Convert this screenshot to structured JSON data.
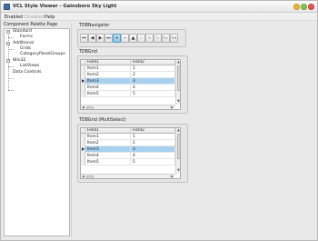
{
  "window": {
    "title": "VCL Style Viewer - Gainsboro Sky Light"
  },
  "menu": {
    "items": [
      "Enabled",
      "Disabled",
      "Help"
    ]
  },
  "left_panel": {
    "header": "Component Palette Page",
    "tree": [
      {
        "label": "Standard",
        "expanded": true
      },
      {
        "label": "Forms",
        "expanded": null
      },
      {
        "label": "Additional",
        "expanded": true
      },
      {
        "label": "Grids",
        "expanded": null
      },
      {
        "label": "CategoryPanelGroups",
        "expanded": null
      },
      {
        "label": "Win32",
        "expanded": true
      },
      {
        "label": "ListViews",
        "expanded": null
      },
      {
        "label": "Data Controls",
        "expanded": null
      }
    ]
  },
  "navigator_group": {
    "label": "TDBNavigator",
    "buttons": [
      {
        "icon": "first-record-icon",
        "glyph": "⏮"
      },
      {
        "icon": "prior-record-icon",
        "glyph": "◀"
      },
      {
        "icon": "next-record-icon",
        "glyph": "▶"
      },
      {
        "icon": "last-record-icon",
        "glyph": "⏭"
      },
      {
        "icon": "insert-record-icon",
        "glyph": "+",
        "active": true
      },
      {
        "icon": "delete-record-icon",
        "glyph": "−"
      },
      {
        "icon": "edit-record-icon",
        "glyph": "▲"
      },
      {
        "icon": "post-edit-icon",
        "glyph": "✓",
        "dim": true
      },
      {
        "icon": "cancel-edit-icon",
        "glyph": "✕",
        "dim": true
      },
      {
        "icon": "refresh-data-icon",
        "glyph": "↻",
        "dim": true
      },
      {
        "icon": "apply-updates-icon",
        "glyph": "↰✓"
      },
      {
        "icon": "cancel-updates-icon",
        "glyph": "↰✕"
      }
    ]
  },
  "grid1": {
    "label": "TDBGrid",
    "columns": [
      "Field1",
      "Field2"
    ],
    "rows": [
      {
        "field1": "Item1",
        "field2": "1"
      },
      {
        "field1": "Item2",
        "field2": "2"
      },
      {
        "field1": "Item3",
        "field2": "3"
      },
      {
        "field1": "Item4",
        "field2": "4"
      },
      {
        "field1": "Item5",
        "field2": "5"
      }
    ],
    "selected_index": 2
  },
  "grid2": {
    "label": "TDBGrid (MultiSelect)",
    "columns": [
      "Field1",
      "Field2"
    ],
    "rows": [
      {
        "field1": "Item1",
        "field2": "1"
      },
      {
        "field1": "Item2",
        "field2": "2"
      },
      {
        "field1": "Item3",
        "field2": "3"
      },
      {
        "field1": "Item4",
        "field2": "4"
      },
      {
        "field1": "Item5",
        "field2": "5"
      }
    ],
    "selected_index": 2
  },
  "colors": {
    "accent": "#5a9ccc",
    "selection": "#a7d1ef"
  }
}
